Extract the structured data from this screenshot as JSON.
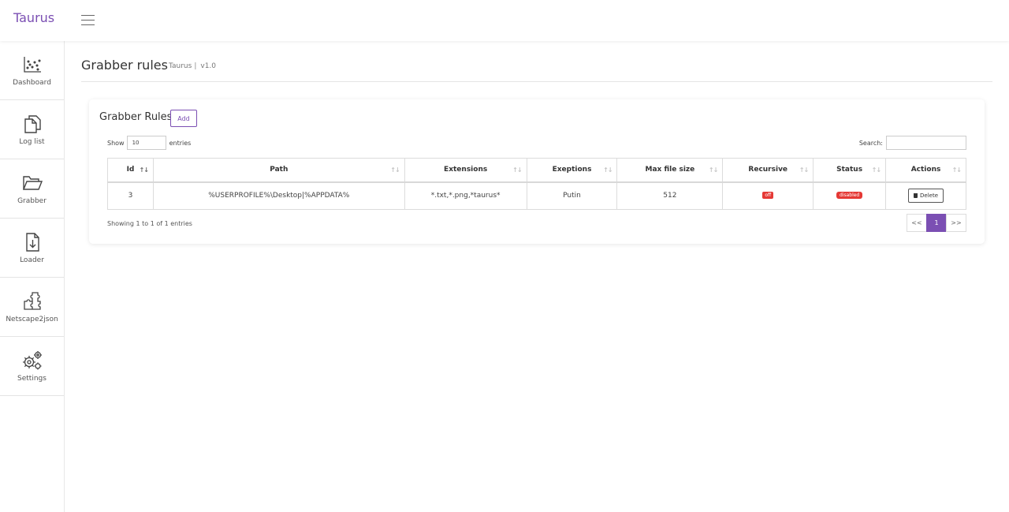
{
  "brand": "Taurus",
  "sidebar": {
    "items": [
      {
        "label": "Dashboard",
        "icon": "chart-icon"
      },
      {
        "label": "Log list",
        "icon": "copy-icon"
      },
      {
        "label": "Grabber",
        "icon": "folder-open-icon"
      },
      {
        "label": "Loader",
        "icon": "file-download-icon"
      },
      {
        "label": "Netscape2json",
        "icon": "puzzle-icon"
      },
      {
        "label": "Settings",
        "icon": "gears-icon"
      }
    ]
  },
  "header": {
    "title": "Grabber rules",
    "crumb_app": "Taurus",
    "crumb_sep": "|",
    "version": "v1.0"
  },
  "card": {
    "title": "Grabber Rules",
    "add_label": "Add",
    "show_label": "Show",
    "show_value": "10",
    "entries_label": "entries",
    "search_label": "Search:",
    "search_value": ""
  },
  "table": {
    "columns": [
      "Id",
      "Path",
      "Extensions",
      "Exeptions",
      "Max file size",
      "Recursive",
      "Status",
      "Actions"
    ],
    "rows": [
      {
        "id": "3",
        "path": "%USERPROFILE%\\Desktop|%APPDATA%",
        "extensions": "*.txt,*.png,*taurus*",
        "exceptions": "Putin",
        "max_file_size": "512",
        "recursive": "off",
        "status": "disabled",
        "action": "Delete"
      }
    ]
  },
  "footer": {
    "info": "Showing 1 to 1 of 1 entries",
    "prev": "<<",
    "page": "1",
    "next": ">>"
  },
  "colors": {
    "accent": "#7b4fb3",
    "danger": "#e53935"
  }
}
